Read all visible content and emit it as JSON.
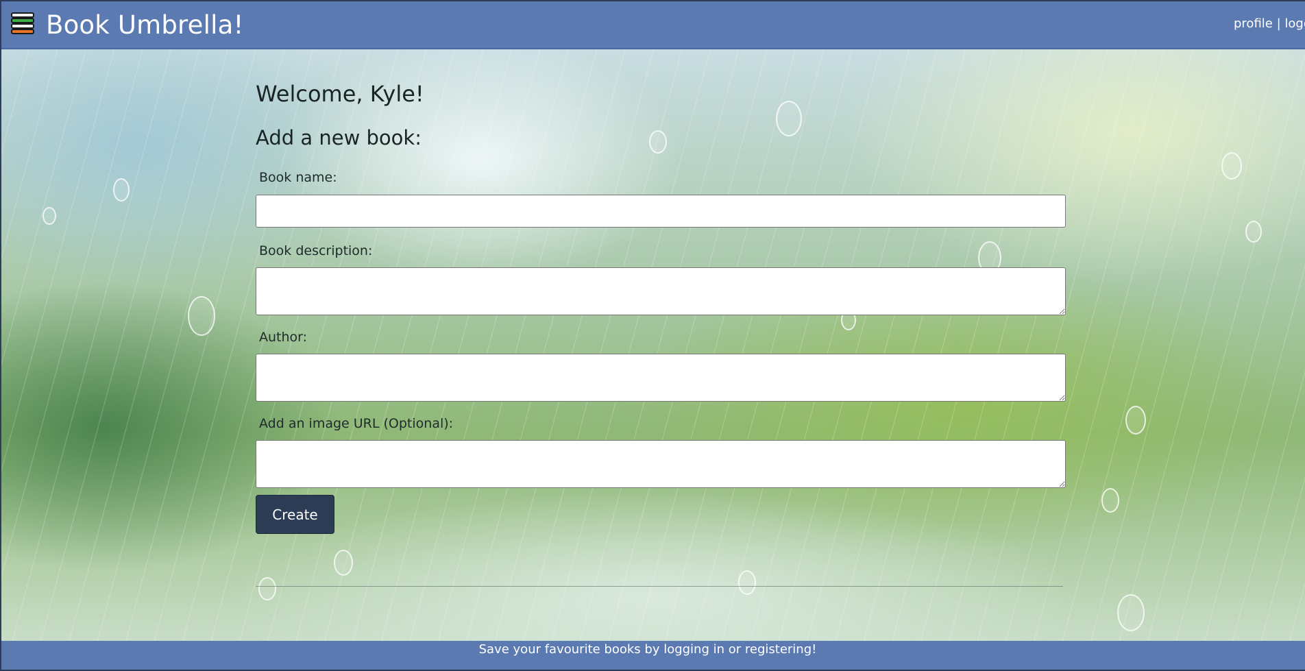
{
  "navbar": {
    "brand": "Book Umbrella!",
    "logo_icon": "stacked-books-icon",
    "links": {
      "profile": "profile",
      "separator": " | ",
      "logout": "logout"
    },
    "bg_color": "#5b7ab1"
  },
  "main": {
    "welcome": "Welcome, Kyle!",
    "form_title": "Add a new book:",
    "fields": {
      "book_name": {
        "label": "Book name:",
        "value": ""
      },
      "description": {
        "label": "Book description:",
        "value": ""
      },
      "author": {
        "label": "Author:",
        "value": ""
      },
      "image_url": {
        "label": "Add an image URL (Optional):",
        "value": ""
      }
    },
    "submit_label": "Create",
    "submit_color": "#2b3c54"
  },
  "footer": {
    "text": "Save your favourite books by logging in or registering!"
  }
}
